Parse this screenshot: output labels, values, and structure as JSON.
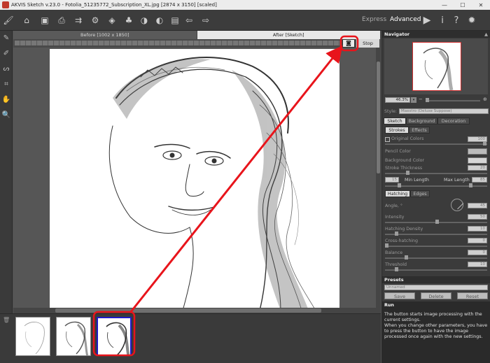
{
  "window": {
    "title": "AKVIS Sketch v.23.0 - Fotolia_51235772_Subscription_XL.jpg [2874 x 3150] [scaled]",
    "minimize": "—",
    "maximize": "☐",
    "close": "✕"
  },
  "toolbar": {
    "express_label": "Express",
    "advanced_label": "Advanced"
  },
  "tabs": {
    "before_label": "Before [1002 x 1850]",
    "after_label": "After [Sketch]"
  },
  "progress": {
    "stop_label": "Stop"
  },
  "navigator": {
    "header": "Navigator",
    "zoom": "46.3%"
  },
  "settings": {
    "style_label": "Style:",
    "style_value": "Maestro (Deluxe Suppose)",
    "tabs": [
      "Sketch",
      "Background",
      "Decoration"
    ],
    "subtabs_strokes": [
      "Strokes",
      "Effects"
    ],
    "original_color_label": "Original Colors",
    "original_color_value": "100",
    "pencil_color_label": "Pencil Color",
    "background_color_label": "Background Color",
    "stroke_thickness_label": "Stroke Thickness",
    "stroke_thickness_value": "20",
    "min_length_value": "15",
    "min_length_label": "Min Length",
    "max_length_label": "Max Length",
    "max_length_value": "85",
    "subtabs_hatching": [
      "Hatching",
      "Edges"
    ],
    "angle_label": "Angle, °",
    "angle_value": "45",
    "intensity_label": "Intensity",
    "intensity_value": "50",
    "hatching_density_label": "Hatching Density",
    "hatching_density_value": "10",
    "cross_hatching_label": "Cross-hatching",
    "cross_hatching_value": "0",
    "balance_label": "Balance",
    "balance_value": "0",
    "threshold_label": "Threshold",
    "threshold_value": "10"
  },
  "presets": {
    "header": "Presets",
    "value": "Unnamed",
    "save_label": "Save",
    "delete_label": "Delete",
    "reset_label": "Reset"
  },
  "help": {
    "title": "Run",
    "text1": "The button starts image processing with the current settings.",
    "text2": "When you change other parameters, you have to press the button to have the image processed once again with the new settings."
  },
  "colors": {
    "callout_red": "#e8141b",
    "selection_blue": "#1d1ac8"
  }
}
